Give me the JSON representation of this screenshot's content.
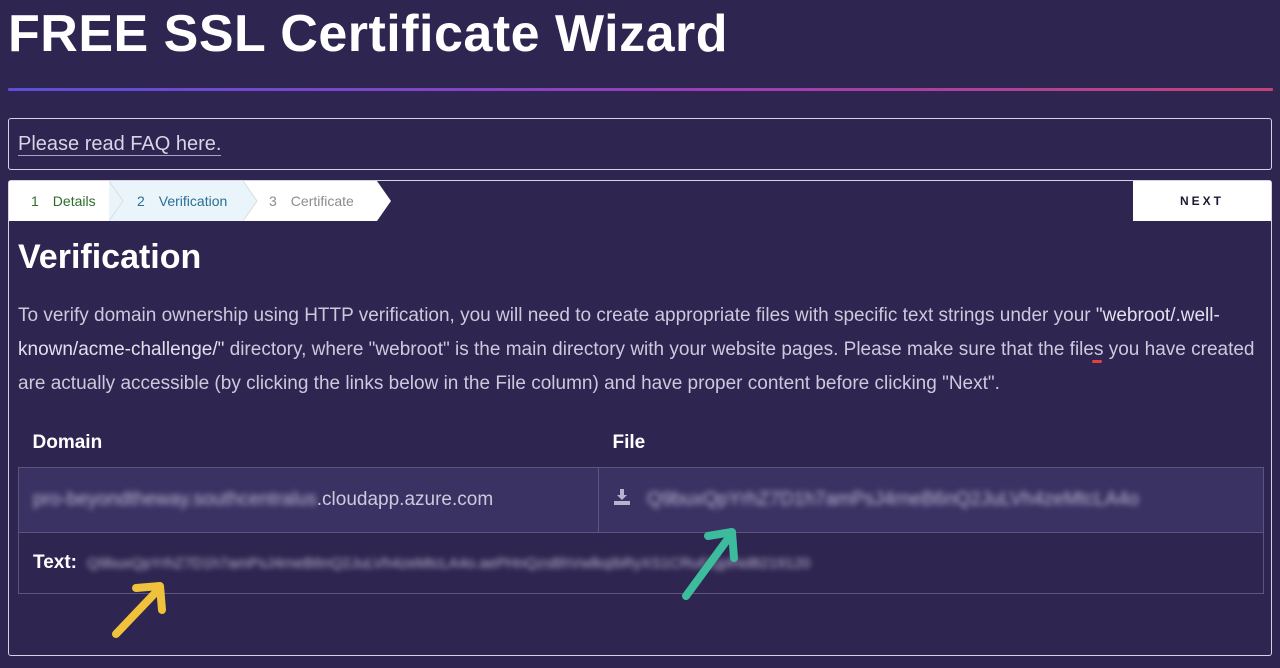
{
  "page": {
    "title": "FREE SSL Certificate Wizard"
  },
  "faq": {
    "link_text": "Please read FAQ here."
  },
  "steps": [
    {
      "number": "1",
      "label": "Details"
    },
    {
      "number": "2",
      "label": "Verification"
    },
    {
      "number": "3",
      "label": "Certificate"
    }
  ],
  "actions": {
    "next_label": "NEXT"
  },
  "verification": {
    "heading": "Verification",
    "intro_before": "To verify domain ownership using HTTP verification, you will need to create appropriate files with specific text strings under your ",
    "intro_highlight": "\"webroot/.well-known/acme-challenge/\"",
    "intro_after": " directory, where \"webroot\" is the main directory with your website pages. Please make sure that the files you have created are actually accessible (by clicking the links below in the File column) and have proper content before clicking \"Next\"."
  },
  "table": {
    "headers": {
      "domain": "Domain",
      "file": "File"
    },
    "row": {
      "domain_prefix_redacted": "pro-beyondtheway.southcentralus",
      "domain_suffix": ".cloudapp.azure.com",
      "file_name_redacted": "Q9buxQpYrhZ7D1h7amPsJ4rneB6nQ2JuLVh4zeMtcLA4o"
    },
    "text_label": "Text:",
    "text_value_redacted": "Q9buxQpYrhZ7D1h7amPsJ4rneB6nQ2JuLVh4zeMtcLA4o.aePHnQzsBhVwlkqIbRyXS1CRuF1jpfNd8219120"
  },
  "colors": {
    "background": "#2e2550",
    "step_done": "#2c6e2a",
    "step_active": "#2a6f92",
    "step_pending": "#8c8c8c",
    "highlight_underline": "#e3413a",
    "arrow_teal": "#3dbb9d",
    "arrow_yellow": "#f0c23b"
  },
  "icons": {
    "download": "download-icon"
  }
}
